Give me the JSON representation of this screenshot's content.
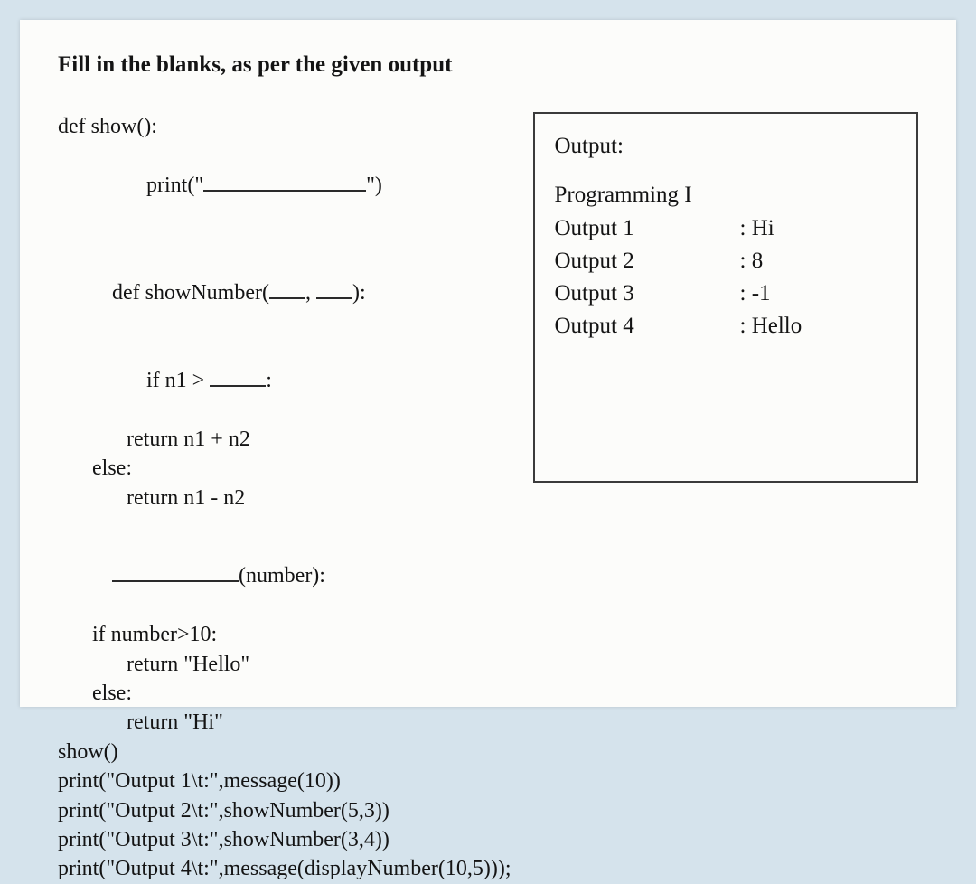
{
  "title": "Fill in the blanks, as per the given output",
  "code": {
    "l1": "def show():",
    "l2a": "print(\"",
    "l2b": "\")",
    "l3a": "def showNumber(",
    "l3sep": ", ",
    "l3b": "):",
    "l4a": "if n1 > ",
    "l4b": ":",
    "l5": "return n1 + n2",
    "l6": "else:",
    "l7": "return n1 - n2",
    "l8": "(number):",
    "l9": "if number>10:",
    "l10": "return \"Hello\"",
    "l11": "else:",
    "l12": "return \"Hi\"",
    "l13": "show()",
    "l14": "print(\"Output 1\\t:\",message(10))",
    "l15": "print(\"Output 2\\t:\",showNumber(5,3))",
    "l16": "print(\"Output 3\\t:\",showNumber(3,4))",
    "l17": "print(\"Output 4\\t:\",message(displayNumber(10,5)));"
  },
  "output": {
    "header": "Output:",
    "programming": "Programming I",
    "rows": [
      {
        "label": "Output 1",
        "value": ": Hi"
      },
      {
        "label": "Output 2",
        "value": ": 8"
      },
      {
        "label": "Output 3",
        "value": ": -1"
      },
      {
        "label": "Output 4",
        "value": ": Hello"
      }
    ]
  }
}
